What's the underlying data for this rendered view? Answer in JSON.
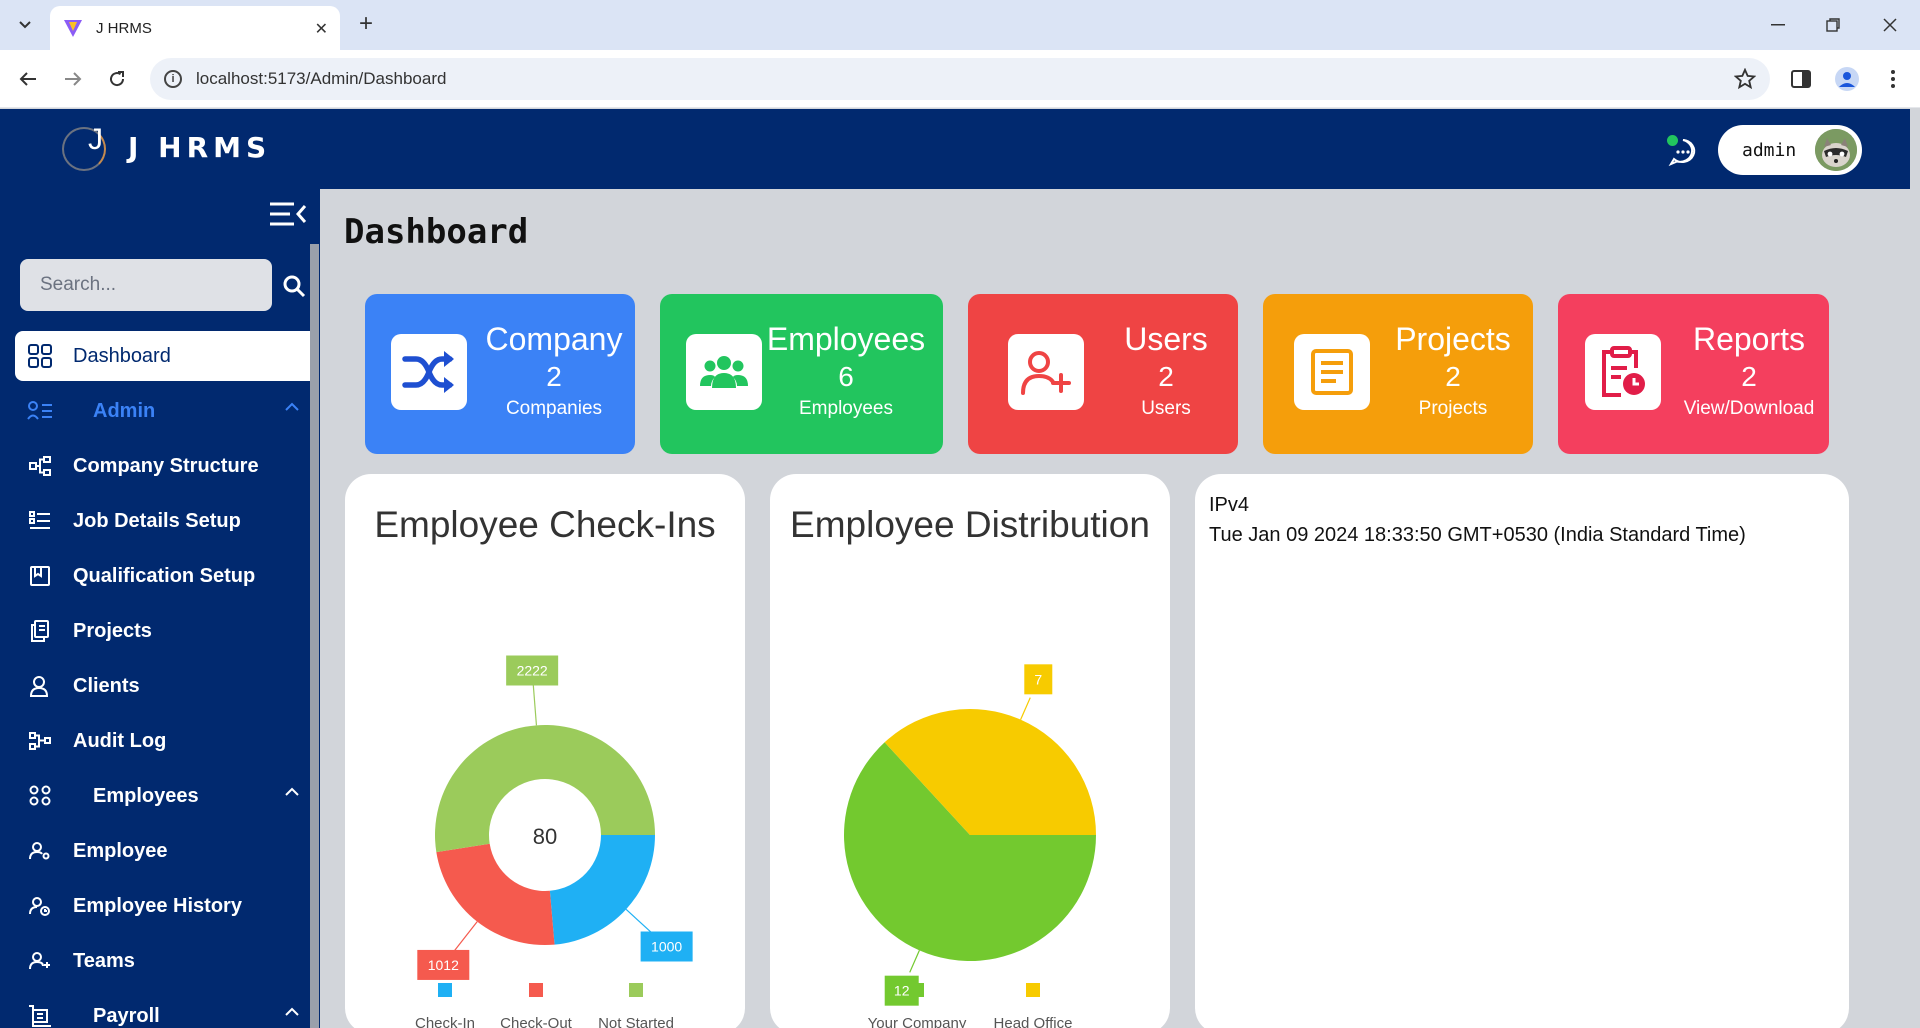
{
  "browser": {
    "tab_title": "J HRMS",
    "url": "localhost:5173/Admin/Dashboard"
  },
  "header": {
    "brand": "J HRMS",
    "logo_letter": "J",
    "user_name": "admin"
  },
  "sidebar": {
    "search_placeholder": "Search...",
    "items": [
      {
        "label": "Dashboard",
        "icon": "grid-icon"
      },
      {
        "label": "Admin",
        "icon": "admin-list-icon"
      },
      {
        "label": "Company Structure",
        "icon": "structure-icon"
      },
      {
        "label": "Job Details Setup",
        "icon": "list-details-icon"
      },
      {
        "label": "Qualification Setup",
        "icon": "certificate-icon"
      },
      {
        "label": "Projects",
        "icon": "documents-icon"
      },
      {
        "label": "Clients",
        "icon": "client-icon"
      },
      {
        "label": "Audit Log",
        "icon": "audit-flow-icon"
      },
      {
        "label": "Employees",
        "icon": "people-group-icon"
      },
      {
        "label": "Employee",
        "icon": "person-gear-icon"
      },
      {
        "label": "Employee History",
        "icon": "person-history-icon"
      },
      {
        "label": "Teams",
        "icon": "team-icon"
      },
      {
        "label": "Payroll",
        "icon": "payroll-icon"
      }
    ]
  },
  "page": {
    "title": "Dashboard"
  },
  "cards": [
    {
      "title": "Company",
      "value": "2",
      "sub": "Companies",
      "color": "#3b82f6",
      "icon": "shuffle-icon"
    },
    {
      "title": "Employees",
      "value": "6",
      "sub": "Employees",
      "color": "#22c55e",
      "icon": "group-icon"
    },
    {
      "title": "Users",
      "value": "2",
      "sub": "Users",
      "color": "#ef4444",
      "icon": "user-plus-icon"
    },
    {
      "title": "Projects",
      "value": "2",
      "sub": "Projects",
      "color": "#f59e0b",
      "icon": "document-icon"
    },
    {
      "title": "Reports",
      "value": "2",
      "sub": "View/Download",
      "color": "#f43f5e",
      "icon": "clipboard-clock-icon"
    }
  ],
  "checkins": {
    "title": "Employee Check-Ins",
    "center_label": "80"
  },
  "distribution": {
    "title": "Employee Distribution"
  },
  "info": {
    "line1": "IPv4",
    "line2": "Tue Jan 09 2024 18:33:50 GMT+0530 (India Standard Time)"
  },
  "chart_data": [
    {
      "type": "pie",
      "title": "Employee Check-Ins",
      "donut": true,
      "categories": [
        "Check-In",
        "Check-Out",
        "Not Started"
      ],
      "values": [
        1000,
        1012,
        2222
      ],
      "colors": [
        "#1fb0f4",
        "#f55a4e",
        "#9bcb5b"
      ],
      "legend": "bottom"
    },
    {
      "type": "pie",
      "title": "Employee Distribution",
      "donut": false,
      "categories": [
        "Your Company",
        "Head Office"
      ],
      "values": [
        12,
        7
      ],
      "colors": [
        "#73c92f",
        "#f7cb00"
      ],
      "legend": "bottom"
    }
  ]
}
